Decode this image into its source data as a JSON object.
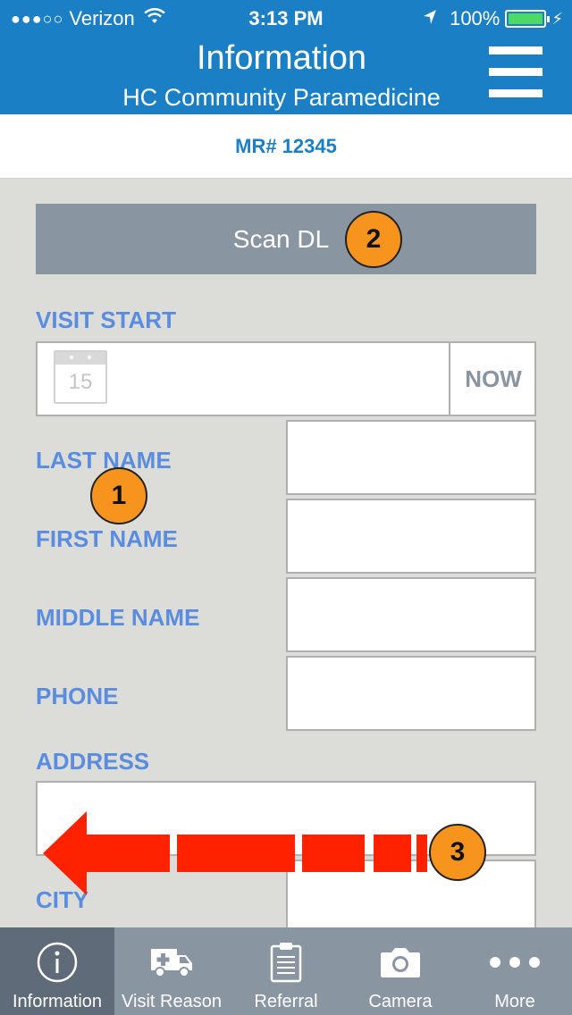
{
  "status_bar": {
    "signal": "●●●○○",
    "carrier": "Verizon",
    "time": "3:13 PM",
    "battery": "100%"
  },
  "header": {
    "title": "Information",
    "subtitle": "HC Community Paramedicine"
  },
  "record": {
    "mr": "MR# 12345"
  },
  "scan_button": {
    "label": "Scan DL"
  },
  "form": {
    "visit_start": {
      "label": "VISIT START",
      "calendar_day": "15",
      "now_label": "NOW",
      "value": ""
    },
    "last_name": {
      "label": "LAST NAME",
      "value": ""
    },
    "first_name": {
      "label": "FIRST NAME",
      "value": ""
    },
    "middle_name": {
      "label": "MIDDLE NAME",
      "value": ""
    },
    "phone": {
      "label": "PHONE",
      "value": ""
    },
    "address": {
      "label": "ADDRESS",
      "value": ""
    },
    "city": {
      "label": "CITY",
      "value": ""
    }
  },
  "annotations": [
    "1",
    "2",
    "3"
  ],
  "tabs": [
    {
      "label": "Information",
      "icon": "info-icon",
      "active": true
    },
    {
      "label": "Visit Reason",
      "icon": "ambulance-icon",
      "active": false
    },
    {
      "label": "Referral",
      "icon": "clipboard-icon",
      "active": false
    },
    {
      "label": "Camera",
      "icon": "camera-icon",
      "active": false
    },
    {
      "label": "More",
      "icon": "more-icon",
      "active": false
    }
  ],
  "colors": {
    "header": "#1a7fc4",
    "label": "#5a8de0",
    "scan_button": "#8a95a2",
    "tab_bar": "#8a95a2",
    "tab_active": "#5f6b78",
    "badge": "#f7941d",
    "arrow": "#ff2200"
  }
}
